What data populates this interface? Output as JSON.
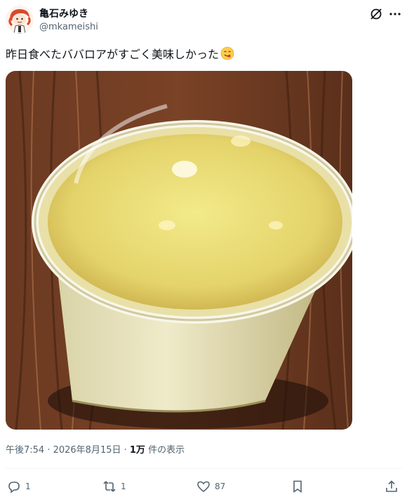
{
  "author": {
    "display_name": "亀石みゆき",
    "handle": "@mkameishi",
    "avatar_icon": "cartoon-avatar-icon"
  },
  "header_icons": {
    "grok": "grok-icon",
    "more": "more-icon"
  },
  "tweet": {
    "text": "昨日食べたババロアがすごく美味しかった",
    "emoji_icon": "yum-face-emoji-icon"
  },
  "media": {
    "photo_icon": "bavarois-cup-photo",
    "alt_button_icon": "image-info-icon"
  },
  "meta": {
    "timestamp": "午後7:54 · 2026年8月15日 · ",
    "views_count": "1万",
    "views_label": " 件の表示"
  },
  "actions": {
    "replies": "1",
    "reposts": "1",
    "likes": "87"
  },
  "colors": {
    "text_primary": "#0f1419",
    "text_secondary": "#536471",
    "divider": "#eff3f4"
  }
}
